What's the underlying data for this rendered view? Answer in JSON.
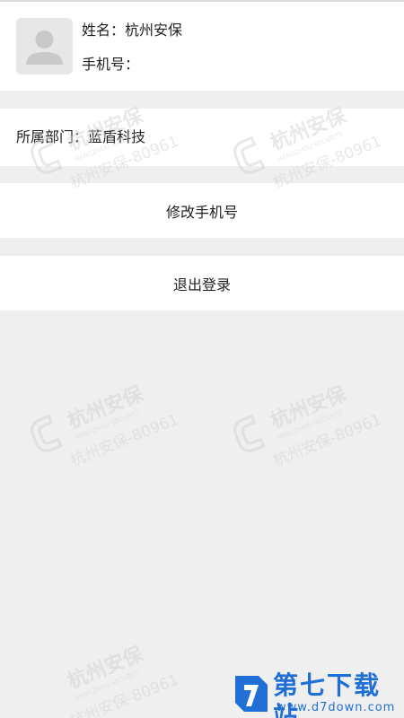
{
  "profile": {
    "name_label": "姓名：",
    "name_value": "杭州安保",
    "phone_label": "手机号：",
    "phone_value": ""
  },
  "department": {
    "label": "所属部门：",
    "value": "蓝盾科技"
  },
  "actions": {
    "modify_phone": "修改手机号",
    "logout": "退出登录"
  },
  "watermark": {
    "company": "杭州安保",
    "english": "HANGZHOU SECURITY",
    "line2": "杭州安保-80961"
  },
  "site_brand": {
    "name": "第七下载站",
    "url": "www.d7down.com"
  },
  "colors": {
    "background": "#efefef",
    "card": "#ffffff",
    "watermark": "#d6d6d6",
    "brand": "#1f6fd6"
  }
}
